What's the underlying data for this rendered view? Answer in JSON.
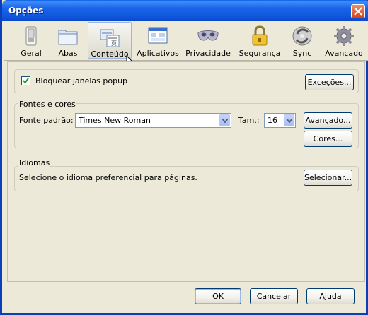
{
  "window": {
    "title": "Opções"
  },
  "toolbar": {
    "items": [
      {
        "label": "Geral",
        "icon": "switch-icon"
      },
      {
        "label": "Abas",
        "icon": "folder-tabs-icon"
      },
      {
        "label": "Conteúdo",
        "icon": "content-page-icon",
        "selected": true
      },
      {
        "label": "Aplicativos",
        "icon": "applications-window-icon"
      },
      {
        "label": "Privacidade",
        "icon": "mask-icon"
      },
      {
        "label": "Segurança",
        "icon": "padlock-icon"
      },
      {
        "label": "Sync",
        "icon": "sync-icon"
      },
      {
        "label": "Avançado",
        "icon": "gear-icon"
      }
    ]
  },
  "popup": {
    "checkbox_label": "Bloquear janelas popup",
    "checked": true,
    "exceptions_button": "Exceções..."
  },
  "fonts": {
    "group_title": "Fontes e cores",
    "default_font_label": "Fonte padrão:",
    "default_font_value": "Times New Roman",
    "size_label": "Tam.:",
    "size_value": "16",
    "advanced_button": "Avançado...",
    "colors_button": "Cores..."
  },
  "languages": {
    "group_title": "Idiomas",
    "description": "Selecione o idioma preferencial para páginas.",
    "select_button": "Selecionar..."
  },
  "footer": {
    "ok_button": "OK",
    "cancel_button": "Cancelar",
    "help_button": "Ajuda"
  }
}
